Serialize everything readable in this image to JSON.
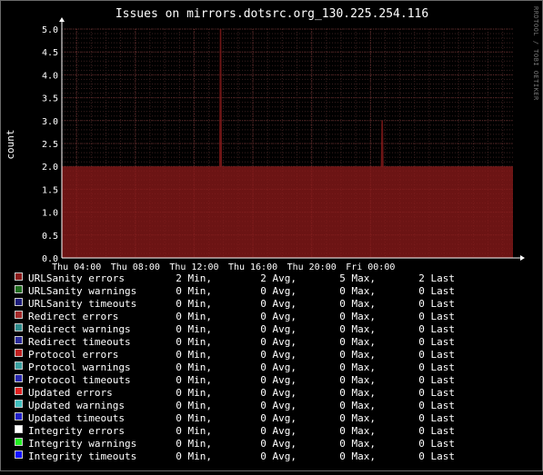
{
  "chart_data": {
    "type": "area",
    "title": "Issues on mirrors.dotsrc.org_130.225.254.116",
    "ylabel": "count",
    "xlabel": "",
    "watermark": "RRDTOOL / TOBI OETIKER",
    "ylim": [
      0,
      5
    ],
    "y_ticks": [
      "0.0",
      "0.5",
      "1.0",
      "1.5",
      "2.0",
      "2.5",
      "3.0",
      "3.5",
      "4.0",
      "4.5",
      "5.0"
    ],
    "x_ticks": [
      "Thu 04:00",
      "Thu 08:00",
      "Thu 12:00",
      "Thu 16:00",
      "Thu 20:00",
      "Fri 00:00"
    ],
    "x_range_hours": [
      0,
      30.7
    ],
    "grid": true,
    "series": [
      {
        "name": "URLSanity errors",
        "color": "#8b1a1a",
        "points": [
          [
            0,
            2
          ],
          [
            10.7,
            2
          ],
          [
            10.75,
            5
          ],
          [
            10.85,
            5
          ],
          [
            10.9,
            2
          ],
          [
            21.7,
            2
          ],
          [
            21.75,
            3
          ],
          [
            21.85,
            3
          ],
          [
            21.9,
            2
          ],
          [
            30.7,
            2
          ]
        ]
      }
    ],
    "legend": [
      {
        "name": "URLSanity errors",
        "color": "#8b1a1a",
        "min": "2 Min,",
        "avg": "2 Avg,",
        "max": "5 Max,",
        "last": "2 Last"
      },
      {
        "name": "URLSanity warnings",
        "color": "#1f6e1f",
        "min": "0 Min,",
        "avg": "0 Avg,",
        "max": "0 Max,",
        "last": "0 Last"
      },
      {
        "name": "URLSanity timeouts",
        "color": "#1c1c7a",
        "min": "0 Min,",
        "avg": "0 Avg,",
        "max": "0 Max,",
        "last": "0 Last"
      },
      {
        "name": "Redirect errors",
        "color": "#a52a2a",
        "min": "0 Min,",
        "avg": "0 Avg,",
        "max": "0 Max,",
        "last": "0 Last"
      },
      {
        "name": "Redirect warnings",
        "color": "#2e8b8b",
        "min": "0 Min,",
        "avg": "0 Avg,",
        "max": "0 Max,",
        "last": "0 Last"
      },
      {
        "name": "Redirect timeouts",
        "color": "#2a2a9a",
        "min": "0 Min,",
        "avg": "0 Avg,",
        "max": "0 Max,",
        "last": "0 Last"
      },
      {
        "name": "Protocol errors",
        "color": "#c02020",
        "min": "0 Min,",
        "avg": "0 Avg,",
        "max": "0 Max,",
        "last": "0 Last"
      },
      {
        "name": "Protocol warnings",
        "color": "#3aa0a0",
        "min": "0 Min,",
        "avg": "0 Avg,",
        "max": "0 Max,",
        "last": "0 Last"
      },
      {
        "name": "Protocol timeouts",
        "color": "#2828b0",
        "min": "0 Min,",
        "avg": "0 Avg,",
        "max": "0 Max,",
        "last": "0 Last"
      },
      {
        "name": "Updated errors",
        "color": "#e02020",
        "min": "0 Min,",
        "avg": "0 Avg,",
        "max": "0 Max,",
        "last": "0 Last"
      },
      {
        "name": "Updated warnings",
        "color": "#40c0c0",
        "min": "0 Min,",
        "avg": "0 Avg,",
        "max": "0 Max,",
        "last": "0 Last"
      },
      {
        "name": "Updated timeouts",
        "color": "#2020c8",
        "min": "0 Min,",
        "avg": "0 Avg,",
        "max": "0 Max,",
        "last": "0 Last"
      },
      {
        "name": "Integrity errors",
        "color": "#ffffff",
        "min": "0 Min,",
        "avg": "0 Avg,",
        "max": "0 Max,",
        "last": "0 Last"
      },
      {
        "name": "Integrity warnings",
        "color": "#22ee22",
        "min": "0 Min,",
        "avg": "0 Avg,",
        "max": "0 Max,",
        "last": "0 Last"
      },
      {
        "name": "Integrity timeouts",
        "color": "#1010ff",
        "min": "0 Min,",
        "avg": "0 Avg,",
        "max": "0 Max,",
        "last": "0 Last"
      }
    ]
  }
}
